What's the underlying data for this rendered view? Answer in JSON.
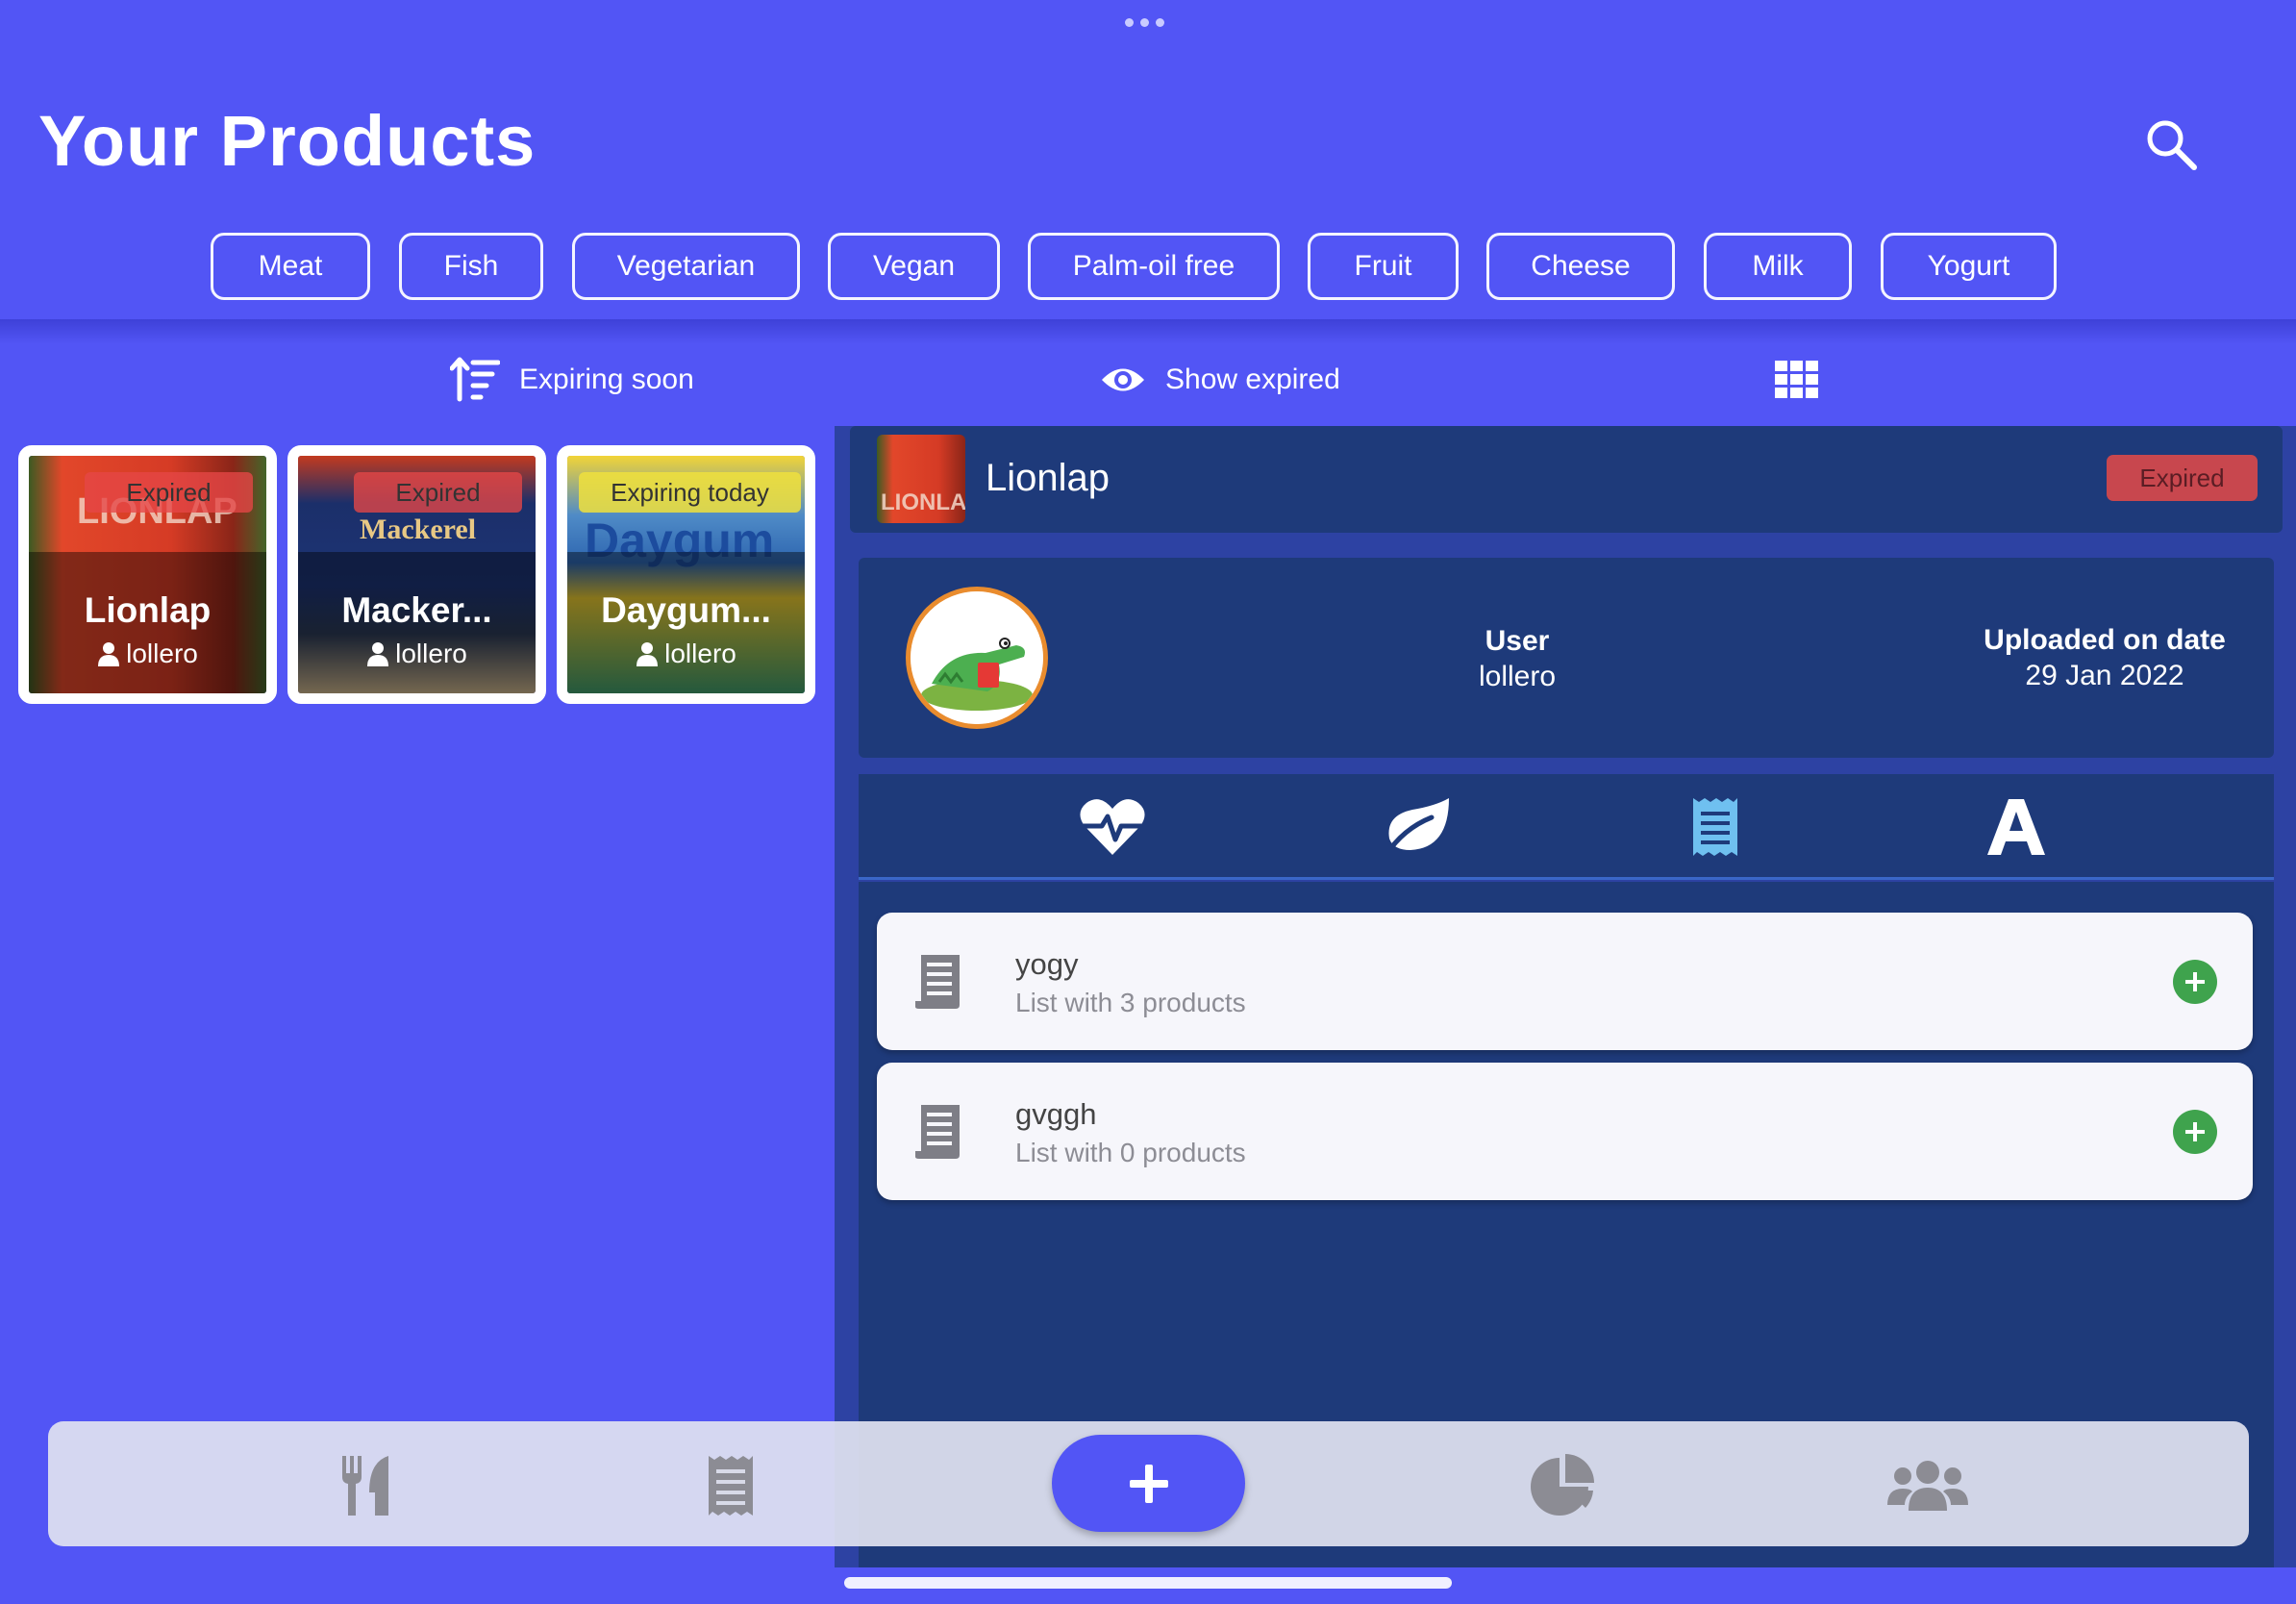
{
  "page_title": "Your Products",
  "filters": [
    "Meat",
    "Fish",
    "Vegetarian",
    "Vegan",
    "Palm-oil free",
    "Fruit",
    "Cheese",
    "Milk",
    "Yogurt"
  ],
  "toolbar": {
    "sort_label": "Expiring soon",
    "show_expired_label": "Show expired"
  },
  "products": [
    {
      "name": "Lionlap",
      "owner": "lollero",
      "status": "Expired",
      "image_text": "LIONLAP"
    },
    {
      "name": "Macker...",
      "owner": "lollero",
      "status": "Expired",
      "image_text": "Mackerel"
    },
    {
      "name": "Daygum...",
      "owner": "lollero",
      "status": "Expiring today",
      "image_text": "Daygum"
    }
  ],
  "detail": {
    "name": "Lionlap",
    "status": "Expired",
    "user_label": "User",
    "user_value": "lollero",
    "date_label": "Uploaded on date",
    "date_value": "29 Jan 2022",
    "tabs": [
      "heart-rate-icon",
      "leaf-icon",
      "receipt-icon",
      "letter-a-icon"
    ],
    "lists": [
      {
        "name": "yogy",
        "subtitle": "List with 3 products"
      },
      {
        "name": "gvggh",
        "subtitle": "List with 0 products"
      }
    ]
  },
  "bottom_nav": [
    "utensils-icon",
    "receipt-icon",
    "plus-icon",
    "pie-chart-icon",
    "users-icon"
  ],
  "colors": {
    "background": "#5255F5",
    "panel": "#1E3A7A",
    "expired": "#C8474E",
    "expiring_today": "#F0E13C",
    "add_green": "#3FA34D",
    "active_tab": "#6FC0F0"
  }
}
